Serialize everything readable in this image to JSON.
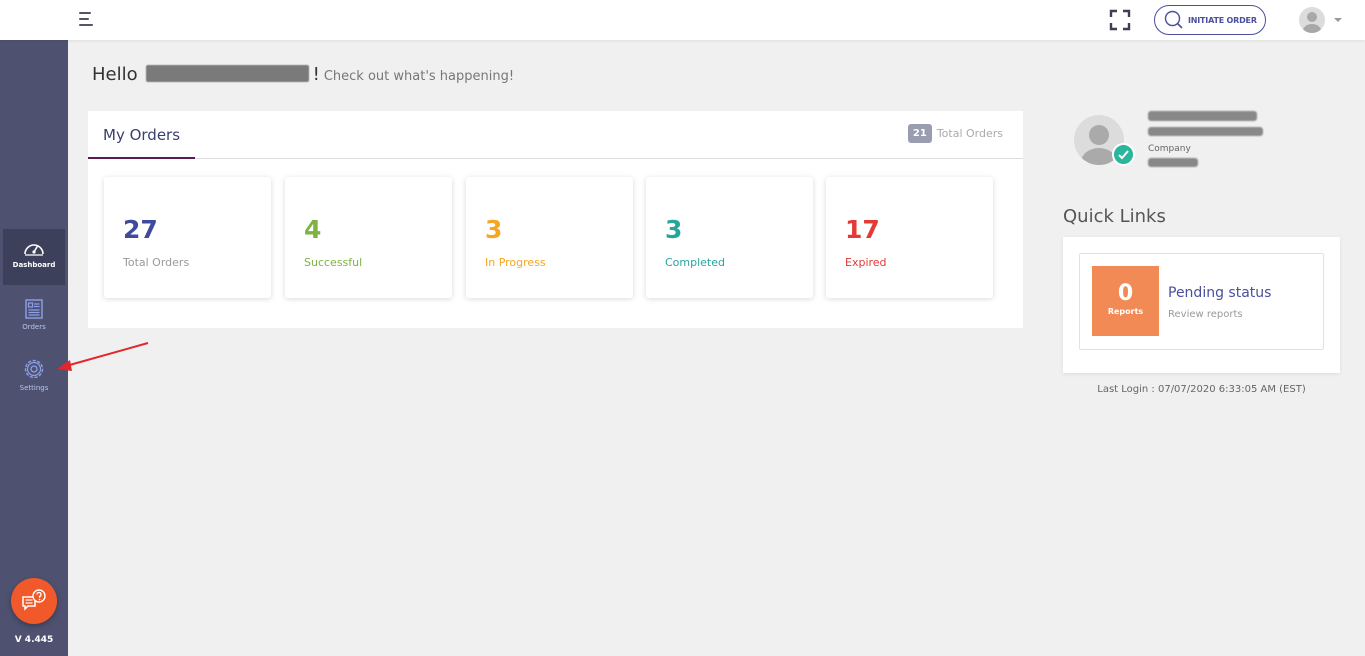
{
  "header": {
    "initiate_label": "INITIATE ORDER"
  },
  "sidebar": {
    "items": [
      {
        "label": "Dashboard",
        "icon": "dashboard-gauge-icon",
        "active": true
      },
      {
        "label": "Orders",
        "icon": "orders-list-icon",
        "active": false
      },
      {
        "label": "Settings",
        "icon": "gear-icon",
        "active": false
      }
    ],
    "version": "V 4.445"
  },
  "greeting": {
    "hello": "Hello",
    "exclaim": "!",
    "sub": "Check out what's happening!"
  },
  "orders": {
    "tab_label": "My Orders",
    "total_count": "21",
    "total_label": "Total Orders",
    "stats": [
      {
        "value": "27",
        "label": "Total Orders",
        "color": "#3f4a9e",
        "label_color": "#999999"
      },
      {
        "value": "4",
        "label": "Successful",
        "color": "#7cb342",
        "label_color": "#7cb342"
      },
      {
        "value": "3",
        "label": "In Progress",
        "color": "#f5a623",
        "label_color": "#f5a623"
      },
      {
        "value": "3",
        "label": "Completed",
        "color": "#26a69a",
        "label_color": "#26a69a"
      },
      {
        "value": "17",
        "label": "Expired",
        "color": "#e53935",
        "label_color": "#e53935"
      }
    ]
  },
  "profile": {
    "company_label": "Company"
  },
  "quick_links": {
    "title": "Quick Links",
    "items": [
      {
        "count": "0",
        "count_label": "Reports",
        "heading": "Pending status",
        "sub": "Review reports",
        "tile_color": "#f28a55"
      }
    ]
  },
  "last_login": "Last Login : 07/07/2020 6:33:05 AM (EST)"
}
